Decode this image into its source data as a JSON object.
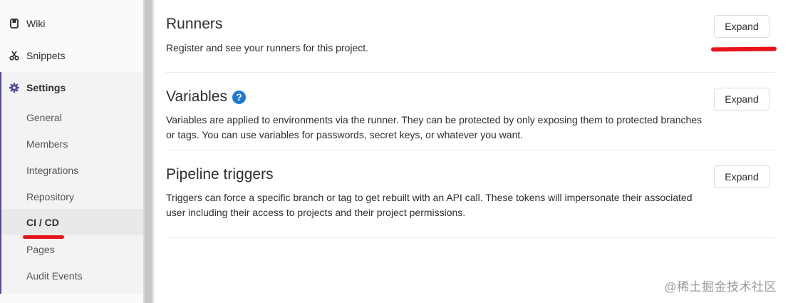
{
  "sidebar": {
    "top_items": [
      {
        "label": "Wiki",
        "icon": "book-icon"
      },
      {
        "label": "Snippets",
        "icon": "scissors-icon"
      }
    ],
    "settings": {
      "label": "Settings",
      "icon": "gear-icon",
      "sub_items": [
        {
          "label": "General"
        },
        {
          "label": "Members"
        },
        {
          "label": "Integrations"
        },
        {
          "label": "Repository"
        },
        {
          "label": "CI / CD",
          "active": true
        },
        {
          "label": "Pages"
        },
        {
          "label": "Audit Events"
        }
      ]
    }
  },
  "sections": [
    {
      "title": "Runners",
      "description": "Register and see your runners for this project.",
      "button": "Expand"
    },
    {
      "title": "Variables",
      "has_help": true,
      "help_glyph": "?",
      "description": "Variables are applied to environments via the runner. They can be protected by only exposing them to protected branches or tags. You can use variables for passwords, secret keys, or whatever you want.",
      "button": "Expand"
    },
    {
      "title": "Pipeline triggers",
      "description": "Triggers can force a specific branch or tag to get rebuilt with an API call. These tokens will impersonate their associated user including their access to projects and their project permissions.",
      "button": "Expand"
    }
  ],
  "watermark": "@稀土掘金技术社区",
  "colors": {
    "accent": "#4b4ba3",
    "annotation_red": "#e8141b",
    "help_blue": "#1f78d1"
  }
}
